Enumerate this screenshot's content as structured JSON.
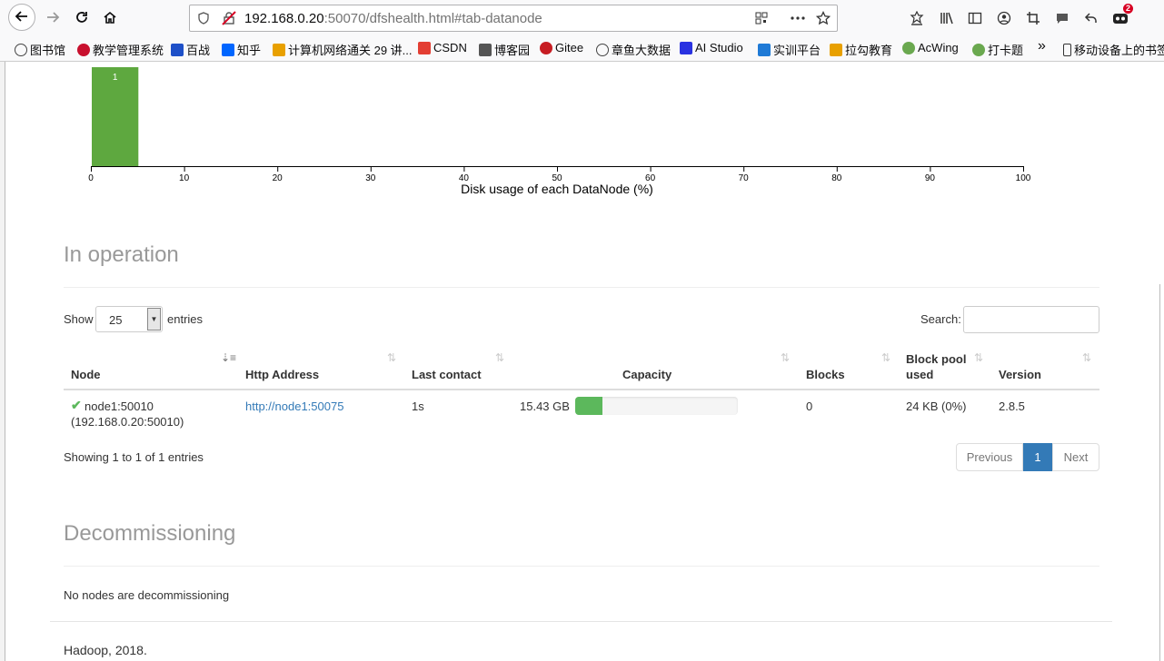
{
  "browser": {
    "url_host": "192.168.0.20",
    "url_rest": ":50070/dfshealth.html#tab-datanode",
    "notification_count": "2",
    "bookmarks": [
      {
        "label": "图书馆",
        "icon": "globe-icon",
        "color": "#444444"
      },
      {
        "label": "教学管理系统",
        "icon": "school-icon",
        "color": "#c8102e"
      },
      {
        "label": "百战",
        "icon": "baizhan-icon",
        "color": "#1e50c8"
      },
      {
        "label": "知乎",
        "icon": "zhihu-icon",
        "color": "#0066ff"
      },
      {
        "label": "计算机网络通关 29 讲...",
        "icon": "grid-icon",
        "color": "#e8a000"
      },
      {
        "label": "CSDN",
        "icon": "csdn-icon",
        "color": "#e33e33"
      },
      {
        "label": "博客园",
        "icon": "cnblogs-icon",
        "color": "#555555"
      },
      {
        "label": "Gitee",
        "icon": "gitee-icon",
        "color": "#c71d23"
      },
      {
        "label": "章鱼大数据",
        "icon": "globe-icon",
        "color": "#444444"
      },
      {
        "label": "AI Studio",
        "icon": "aistudio-icon",
        "color": "#2932e1"
      },
      {
        "label": "实训平台",
        "icon": "dolphin-icon",
        "color": "#1f7ad6"
      },
      {
        "label": "拉勾教育",
        "icon": "grid-icon",
        "color": "#e8a000"
      },
      {
        "label": "AcWing",
        "icon": "acwing-icon",
        "color": "#6aa84f"
      },
      {
        "label": "打卡题",
        "icon": "acwing-icon",
        "color": "#6aa84f"
      }
    ],
    "overflow_label": "»",
    "mobile_bookmarks": "移动设备上的书签"
  },
  "chart_data": {
    "type": "bar",
    "xlabel": "Disk usage of each DataNode (%)",
    "xlim": [
      0,
      100
    ],
    "xticks": [
      0,
      10,
      20,
      30,
      40,
      50,
      60,
      70,
      80,
      90,
      100
    ],
    "bins": [
      {
        "x0": 0,
        "x1": 5,
        "count": 1,
        "label": "1"
      }
    ],
    "bar_color": "#5ea83f"
  },
  "in_operation": {
    "title": "In operation",
    "show_label": "Show",
    "page_size": "25",
    "entries_label": "entries",
    "search_label": "Search:",
    "columns": [
      "Node",
      "Http Address",
      "Last contact",
      "Capacity",
      "Blocks",
      "Block pool",
      "used",
      "Version"
    ],
    "row": {
      "node": "node1:50010",
      "node_ip": "(192.168.0.20:50010)",
      "http": "http://node1:50075",
      "last_contact": "1s",
      "capacity": "15.43 GB",
      "capacity_used_fraction": 0.17,
      "blocks": "0",
      "block_pool_used": "24 KB (0%)",
      "version": "2.8.5"
    },
    "info": "Showing 1 to 1 of 1 entries",
    "pagination": {
      "previous": "Previous",
      "current": "1",
      "next": "Next"
    }
  },
  "decommissioning": {
    "title": "Decommissioning",
    "empty": "No nodes are decommissioning"
  },
  "footer": "Hadoop, 2018."
}
